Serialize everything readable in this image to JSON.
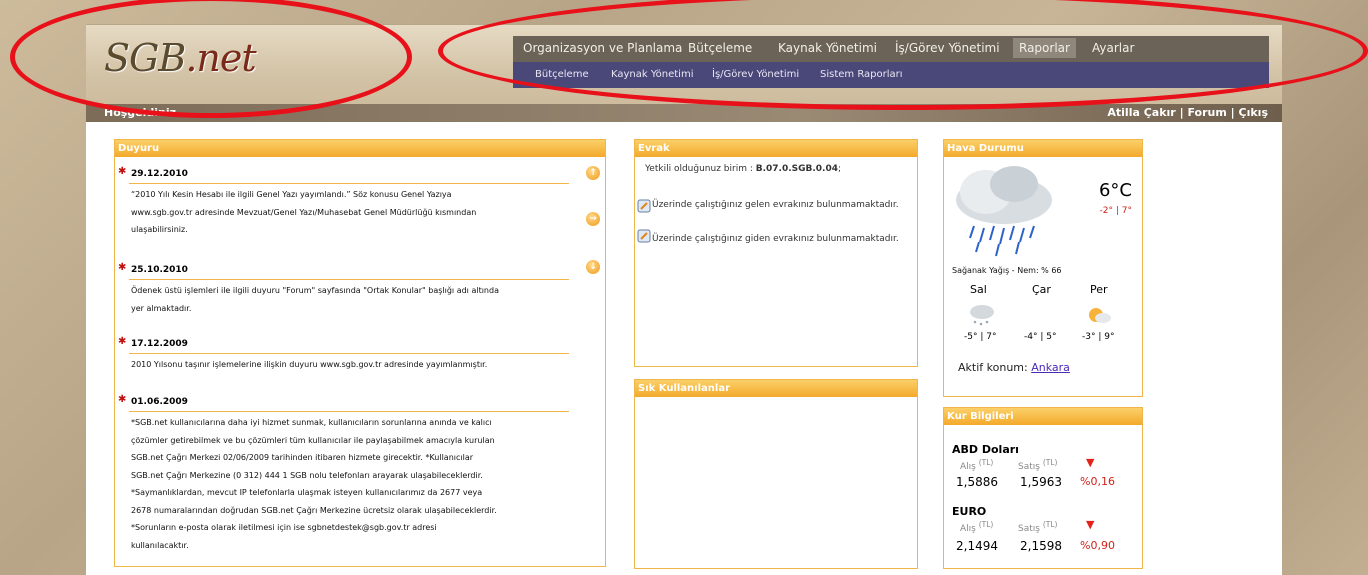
{
  "app": {
    "logo_main": "SGB",
    "logo_suffix": ".net"
  },
  "topnav": [
    "Organizasyon ve Planlama",
    "Bütçeleme",
    "Kaynak Yönetimi",
    "İş/Görev Yönetimi",
    "Raporlar",
    "Ayarlar"
  ],
  "subnav": [
    "Bütçeleme",
    "Kaynak Yönetimi",
    "İş/Görev Yönetimi",
    "Sistem Raporları"
  ],
  "welcome": "Hoşgeldiniz.",
  "user": {
    "name": "Atilla Çakır",
    "sep": "|",
    "forum": "Forum",
    "logout": "Çıkış"
  },
  "duyuru": {
    "title": "Duyuru",
    "items": [
      {
        "date": "29.12.2010",
        "lines": [
          "“2010 Yılı Kesin Hesabı ile ilgili Genel Yazı yayımlandı.” Söz konusu Genel Yazıya",
          "www.sgb.gov.tr adresinde Mevzuat/Genel Yazı/Muhasebat Genel Müdürlüğü kısmından",
          "ulaşabilirsiniz."
        ]
      },
      {
        "date": "25.10.2010",
        "lines": [
          "Ödenek üstü işlemleri ile ilgili duyuru \"Forum\" sayfasında \"Ortak Konular\" başlığı adı altında",
          "yer almaktadır."
        ]
      },
      {
        "date": "17.12.2009",
        "lines": [
          "2010 Yılsonu taşınır işlemelerine ilişkin duyuru www.sgb.gov.tr adresinde yayımlanmıştır."
        ]
      },
      {
        "date": "01.06.2009",
        "lines": [
          "*SGB.net kullanıcılarına daha iyi hizmet sunmak, kullanıcıların sorunlarına anında ve kalıcı",
          "çözümler getirebilmek ve bu çözümleri tüm kullanıcılar ile paylaşabilmek amacıyla kurulan",
          "SGB.net Çağrı Merkezi 02/06/2009 tarihinden itibaren hizmete girecektir. *Kullanıcılar",
          "SGB.net Çağrı Merkezine (0 312) 444 1 SGB nolu telefonları arayarak ulaşabileceklerdir.",
          "*Saymanlıklardan, mevcut IP telefonlarla ulaşmak isteyen kullanıcılarımız da 2677 veya",
          "2678 numaralarından doğrudan SGB.net Çağrı Merkezine ücretsiz olarak ulaşabileceklerdir.",
          "*Sorunların e-posta olarak iletilmesi için ise sgbnetdestek@sgb.gov.tr adresi",
          "kullanılacaktır."
        ]
      }
    ]
  },
  "evrak": {
    "title": "Evrak",
    "unit_prefix": "Yetkili olduğunuz birim : ",
    "unit_code": "B.07.0.SGB.0.04",
    "unit_suffix": ";",
    "incoming": "Üzerinde çalıştığınız gelen evrakınız bulunmamaktadır.",
    "outgoing": "Üzerinde çalıştığınız giden evrakınız bulunmamaktadır."
  },
  "sik": {
    "title": "Sık Kullanılanlar"
  },
  "hava": {
    "title": "Hava Durumu",
    "temp": "6°C",
    "range": "-2° | 7°",
    "desc": "Sağanak Yağış - Nem: % 66",
    "days": [
      {
        "name": "Sal",
        "range": "-5° | 7°"
      },
      {
        "name": "Çar",
        "range": "-4° | 5°"
      },
      {
        "name": "Per",
        "range": "-3° | 9°"
      }
    ],
    "location_label": "Aktif konum: ",
    "location": "Ankara"
  },
  "kur": {
    "title": "Kur Bilgileri",
    "buy_label": "Alış",
    "sell_label": "Satış",
    "unit": "(TL)",
    "items": [
      {
        "name": "ABD Doları",
        "buy": "1,5886",
        "sell": "1,5963",
        "change": "%0,16"
      },
      {
        "name": "EURO",
        "buy": "2,1494",
        "sell": "2,1598",
        "change": "%0,90"
      }
    ]
  },
  "colors": {
    "accent": "#f3a92b",
    "nav": "#6b6357",
    "subnav": "#4a4878",
    "highlight": "#e8111a"
  },
  "icons": [
    "up-arrow-icon",
    "right-arrow-icon",
    "down-arrow-icon",
    "flag-icon",
    "document-icon",
    "rain-cloud-icon",
    "sun-icon",
    "down-red-arrow-icon"
  ]
}
